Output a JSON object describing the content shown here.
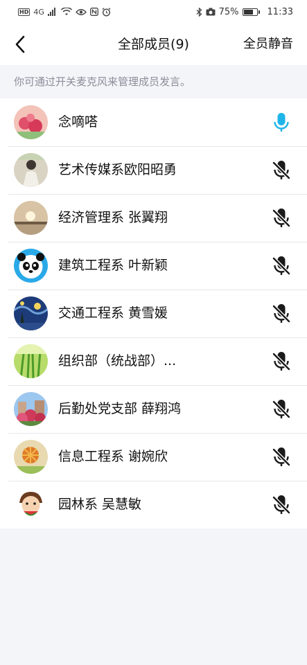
{
  "status_bar": {
    "network": "4G",
    "battery": "75%",
    "battery_level": 0.75,
    "time": "11:33"
  },
  "header": {
    "title": "全部成员(9)",
    "mute_all_label": "全员静音"
  },
  "hint": "你可通过开关麦克风来管理成员发言。",
  "colors": {
    "mic_on": "#1fb5e8",
    "mic_off": "#1a1a1a",
    "divider": "#e6e7ec"
  },
  "members": [
    {
      "name": "念嘀嗒",
      "mic": "mic-on-icon"
    },
    {
      "name": "艺术传媒系欧阳昭勇",
      "mic": "mic-off-icon"
    },
    {
      "name": "经济管理系 张翼翔",
      "mic": "mic-off-icon"
    },
    {
      "name": "建筑工程系 叶新颖",
      "mic": "mic-off-icon"
    },
    {
      "name": "交通工程系 黄雪媛",
      "mic": "mic-off-icon"
    },
    {
      "name": "组织部（统战部）...",
      "mic": "mic-off-icon"
    },
    {
      "name": "后勤处党支部 薛翔鸿",
      "mic": "mic-off-icon"
    },
    {
      "name": "信息工程系 谢婉欣",
      "mic": "mic-off-icon"
    },
    {
      "name": "园林系 吴慧敏",
      "mic": "mic-off-icon"
    }
  ]
}
